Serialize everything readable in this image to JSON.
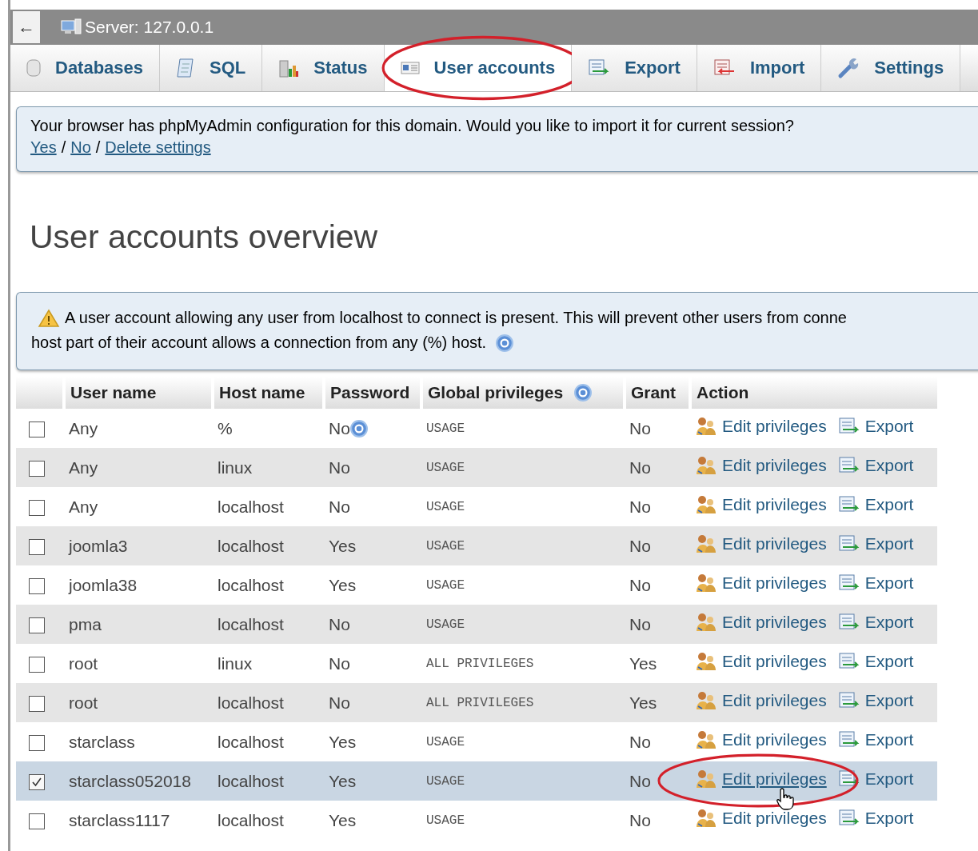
{
  "top_bar": {
    "back": "←",
    "title": "Server: 127.0.0.1"
  },
  "tabs": [
    {
      "label": "Databases",
      "kind": "database",
      "selected": false,
      "circled": false
    },
    {
      "label": "SQL",
      "kind": "sql",
      "selected": false,
      "circled": false
    },
    {
      "label": "Status",
      "kind": "status",
      "selected": false,
      "circled": false
    },
    {
      "label": "User accounts",
      "kind": "users",
      "selected": true,
      "circled": true
    },
    {
      "label": "Export",
      "kind": "export",
      "selected": false,
      "circled": false
    },
    {
      "label": "Import",
      "kind": "import",
      "selected": false,
      "circled": false
    },
    {
      "label": "Settings",
      "kind": "settings",
      "selected": false,
      "circled": false
    }
  ],
  "config_notice": {
    "text": "Your browser has phpMyAdmin configuration for this domain. Would you like to import it for current session?",
    "links": [
      "Yes",
      "No",
      "Delete settings"
    ],
    "separator": "/"
  },
  "heading": "User accounts overview",
  "warning": {
    "line_1": "A user account allowing any user from localhost to connect is present. This will prevent other users from conne",
    "line_2": "host part of their account allows a connection from any (%) host."
  },
  "table": {
    "columns": [
      "User name",
      "Host name",
      "Password",
      "Global privileges",
      "Grant",
      "Action"
    ],
    "rows": [
      {
        "user": "Any",
        "host": "%",
        "password": "No",
        "password_help": true,
        "privileges": "USAGE",
        "grant": "No",
        "edit": "Edit privileges",
        "export": "Export",
        "checked": false,
        "circled": false
      },
      {
        "user": "Any",
        "host": "linux",
        "password": "No",
        "password_help": false,
        "privileges": "USAGE",
        "grant": "No",
        "edit": "Edit privileges",
        "export": "Export",
        "checked": false,
        "circled": false
      },
      {
        "user": "Any",
        "host": "localhost",
        "password": "No",
        "password_help": false,
        "privileges": "USAGE",
        "grant": "No",
        "edit": "Edit privileges",
        "export": "Export",
        "checked": false,
        "circled": false
      },
      {
        "user": "joomla3",
        "host": "localhost",
        "password": "Yes",
        "password_help": false,
        "privileges": "USAGE",
        "grant": "No",
        "edit": "Edit privileges",
        "export": "Export",
        "checked": false,
        "circled": false
      },
      {
        "user": "joomla38",
        "host": "localhost",
        "password": "Yes",
        "password_help": false,
        "privileges": "USAGE",
        "grant": "No",
        "edit": "Edit privileges",
        "export": "Export",
        "checked": false,
        "circled": false
      },
      {
        "user": "pma",
        "host": "localhost",
        "password": "No",
        "password_help": false,
        "privileges": "USAGE",
        "grant": "No",
        "edit": "Edit privileges",
        "export": "Export",
        "checked": false,
        "circled": false
      },
      {
        "user": "root",
        "host": "linux",
        "password": "No",
        "password_help": false,
        "privileges": "ALL PRIVILEGES",
        "grant": "Yes",
        "edit": "Edit privileges",
        "export": "Export",
        "checked": false,
        "circled": false
      },
      {
        "user": "root",
        "host": "localhost",
        "password": "No",
        "password_help": false,
        "privileges": "ALL PRIVILEGES",
        "grant": "Yes",
        "edit": "Edit privileges",
        "export": "Export",
        "checked": false,
        "circled": false
      },
      {
        "user": "starclass",
        "host": "localhost",
        "password": "Yes",
        "password_help": false,
        "privileges": "USAGE",
        "grant": "No",
        "edit": "Edit privileges",
        "export": "Export",
        "checked": false,
        "circled": false
      },
      {
        "user": "starclass052018",
        "host": "localhost",
        "password": "Yes",
        "password_help": false,
        "privileges": "USAGE",
        "grant": "No",
        "edit": "Edit privileges",
        "export": "Export",
        "checked": true,
        "circled": true
      },
      {
        "user": "starclass1117",
        "host": "localhost",
        "password": "Yes",
        "password_help": false,
        "privileges": "USAGE",
        "grant": "No",
        "edit": "Edit privileges",
        "export": "Export",
        "checked": false,
        "circled": false
      }
    ]
  }
}
